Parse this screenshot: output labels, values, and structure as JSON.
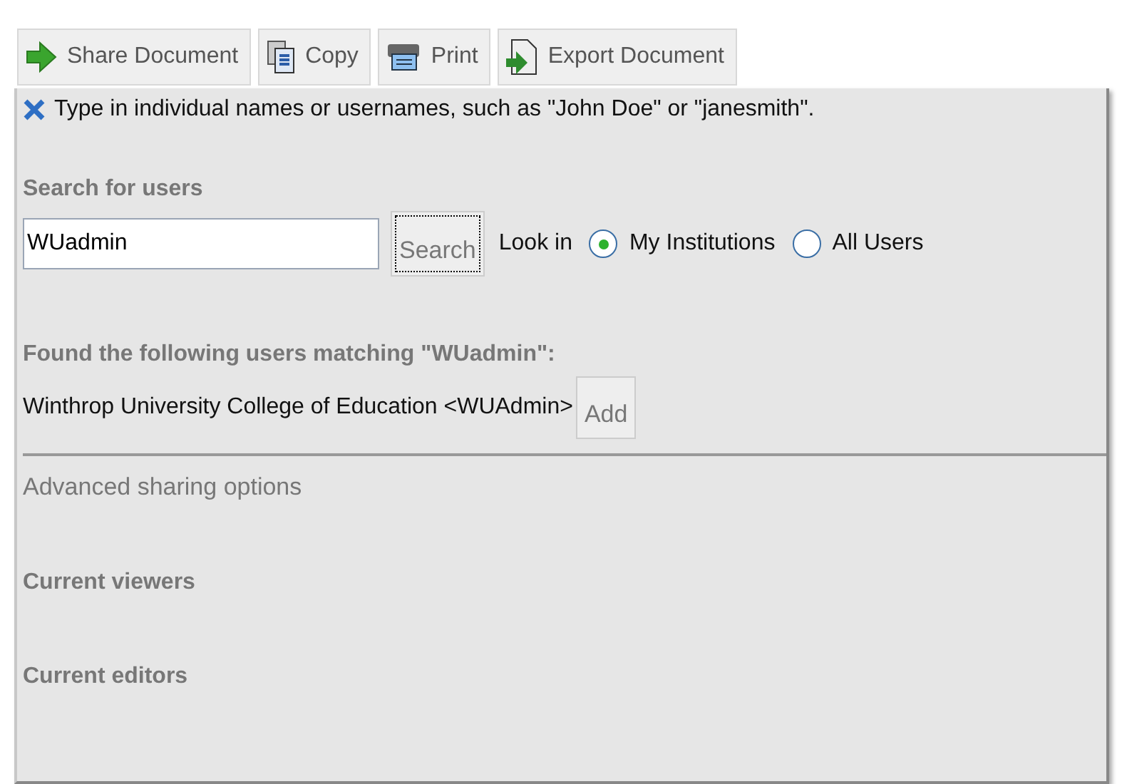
{
  "toolbar": [
    {
      "kind": "share",
      "label": "Share Document"
    },
    {
      "kind": "copy",
      "label": "Copy"
    },
    {
      "kind": "print",
      "label": "Print"
    },
    {
      "kind": "export",
      "label": "Export Document"
    }
  ],
  "hint": "Type in individual names or usernames, such as \"John Doe\" or \"janesmith\".",
  "search": {
    "heading": "Search for users",
    "value": "WUadmin",
    "button": "Search",
    "look_in": "Look in",
    "options": [
      {
        "label": "My Institutions",
        "selected": true
      },
      {
        "label": "All Users",
        "selected": false
      }
    ]
  },
  "results": {
    "heading": "Found the following users matching \"WUadmin\":",
    "users": [
      {
        "name": "Winthrop University College of Education <WUAdmin>",
        "button": "Add"
      }
    ]
  },
  "advanced": "Advanced sharing options",
  "sections": [
    "Current viewers",
    "Current editors"
  ]
}
